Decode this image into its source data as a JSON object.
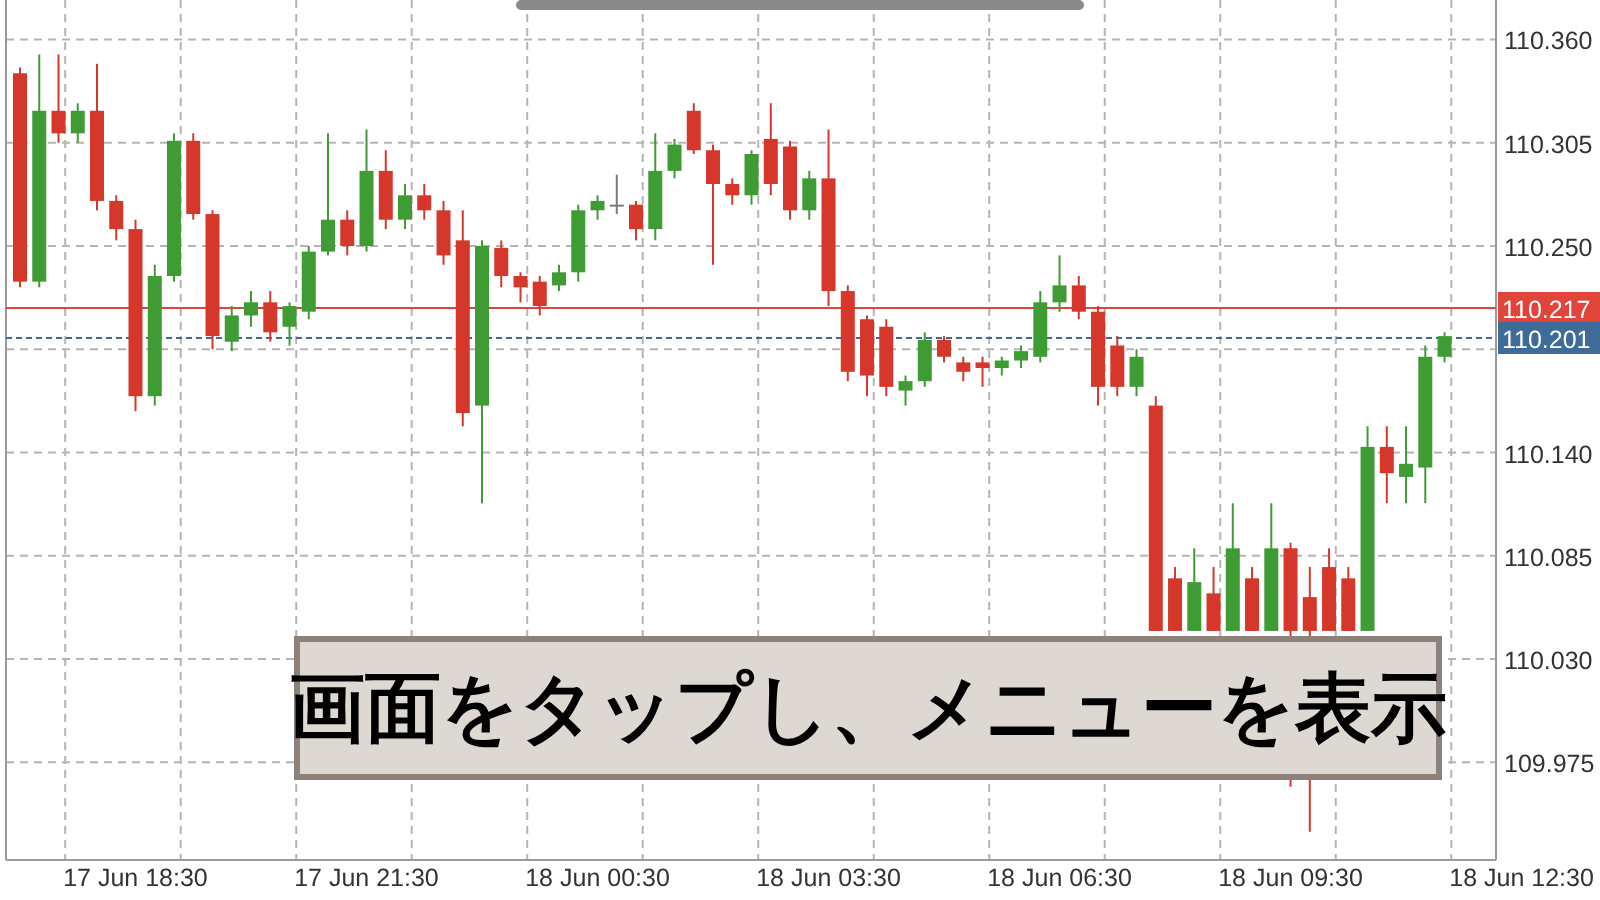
{
  "chart": {
    "chart_data": {
      "type": "candlestick",
      "grid": true,
      "ylim": [
        109.923,
        110.381
      ],
      "yticks": [
        {
          "value": 110.36,
          "label": "110.360"
        },
        {
          "value": 110.305,
          "label": "110.305"
        },
        {
          "value": 110.25,
          "label": "110.250"
        },
        {
          "value": 110.14,
          "label": "110.140"
        },
        {
          "value": 110.085,
          "label": "110.085"
        },
        {
          "value": 110.03,
          "label": "110.030"
        },
        {
          "value": 109.975,
          "label": "109.975"
        }
      ],
      "categories": [
        null,
        null,
        null,
        null,
        null,
        null,
        "17 Jun 18:30",
        null,
        null,
        null,
        null,
        null,
        null,
        null,
        null,
        null,
        null,
        null,
        "17 Jun 21:30",
        null,
        null,
        null,
        null,
        null,
        null,
        null,
        null,
        null,
        null,
        null,
        "18 Jun 00:30",
        null,
        null,
        null,
        null,
        null,
        null,
        null,
        null,
        null,
        null,
        null,
        "18 Jun 03:30",
        null,
        null,
        null,
        null,
        null,
        null,
        null,
        null,
        null,
        null,
        null,
        "18 Jun 06:30",
        null,
        null,
        null,
        null,
        null,
        null,
        null,
        null,
        null,
        null,
        null,
        "18 Jun 09:30",
        null,
        null,
        null,
        null,
        null,
        null,
        null,
        null,
        null,
        null,
        null,
        "18 Jun 12:30"
      ],
      "ohlc": [
        [
          110.342,
          110.345,
          110.228,
          110.231
        ],
        [
          110.231,
          110.352,
          110.228,
          110.322
        ],
        [
          110.322,
          110.352,
          110.305,
          110.31
        ],
        [
          110.31,
          110.326,
          110.305,
          110.322
        ],
        [
          110.322,
          110.347,
          110.269,
          110.274
        ],
        [
          110.274,
          110.277,
          110.253,
          110.259
        ],
        [
          110.259,
          110.264,
          110.162,
          110.17
        ],
        [
          110.17,
          110.24,
          110.165,
          110.234
        ],
        [
          110.234,
          110.31,
          110.231,
          110.306
        ],
        [
          110.306,
          110.31,
          110.264,
          110.267
        ],
        [
          110.267,
          110.269,
          110.195,
          110.202
        ],
        [
          110.199,
          110.218,
          110.194,
          110.213
        ],
        [
          110.213,
          110.226,
          110.207,
          110.22
        ],
        [
          110.22,
          110.226,
          110.199,
          110.204
        ],
        [
          110.207,
          110.22,
          110.197,
          110.218
        ],
        [
          110.215,
          110.25,
          110.211,
          110.247
        ],
        [
          110.247,
          110.31,
          110.245,
          110.264
        ],
        [
          110.264,
          110.269,
          110.245,
          110.25
        ],
        [
          110.25,
          110.312,
          110.247,
          110.29
        ],
        [
          110.29,
          110.301,
          110.259,
          110.264
        ],
        [
          110.264,
          110.283,
          110.259,
          110.277
        ],
        [
          110.277,
          110.283,
          110.264,
          110.269
        ],
        [
          110.269,
          110.274,
          110.24,
          110.245
        ],
        [
          110.253,
          110.269,
          110.154,
          110.161
        ],
        [
          110.165,
          110.253,
          110.113,
          110.25
        ],
        [
          110.249,
          110.253,
          110.228,
          110.234
        ],
        [
          110.234,
          110.236,
          110.22,
          110.228
        ],
        [
          110.231,
          110.234,
          110.213,
          110.218
        ],
        [
          110.229,
          110.24,
          110.226,
          110.236
        ],
        [
          110.236,
          110.272,
          110.231,
          110.269
        ],
        [
          110.269,
          110.277,
          110.264,
          110.274
        ],
        [
          110.272,
          110.288,
          110.267,
          110.272
        ],
        [
          110.272,
          110.274,
          110.253,
          110.259
        ],
        [
          110.259,
          110.31,
          110.253,
          110.29
        ],
        [
          110.29,
          110.307,
          110.286,
          110.304
        ],
        [
          110.322,
          110.326,
          110.299,
          110.301
        ],
        [
          110.301,
          110.304,
          110.24,
          110.283
        ],
        [
          110.283,
          110.286,
          110.272,
          110.277
        ],
        [
          110.277,
          110.301,
          110.272,
          110.299
        ],
        [
          110.307,
          110.326,
          110.277,
          110.283
        ],
        [
          110.303,
          110.306,
          110.264,
          110.269
        ],
        [
          110.269,
          110.29,
          110.264,
          110.286
        ],
        [
          110.286,
          110.312,
          110.218,
          110.226
        ],
        [
          110.226,
          110.229,
          110.178,
          110.183
        ],
        [
          110.211,
          110.213,
          110.17,
          110.181
        ],
        [
          110.207,
          110.211,
          110.17,
          110.175
        ],
        [
          110.173,
          110.181,
          110.165,
          110.178
        ],
        [
          110.178,
          110.204,
          110.175,
          110.2
        ],
        [
          110.2,
          110.202,
          110.188,
          110.191
        ],
        [
          110.188,
          110.191,
          110.178,
          110.183
        ],
        [
          110.188,
          110.191,
          110.175,
          110.185
        ],
        [
          110.185,
          110.191,
          110.181,
          110.189
        ],
        [
          110.189,
          110.197,
          110.185,
          110.194
        ],
        [
          110.191,
          110.226,
          110.188,
          110.22
        ],
        [
          110.22,
          110.245,
          110.215,
          110.229
        ],
        [
          110.229,
          110.234,
          110.211,
          110.215
        ],
        [
          110.215,
          110.218,
          110.165,
          110.175
        ],
        [
          110.197,
          110.202,
          110.17,
          110.175
        ],
        [
          110.175,
          110.195,
          110.17,
          110.191
        ],
        [
          110.165,
          110.17,
          110.045,
          110.045
        ],
        [
          110.073,
          110.079,
          110.045,
          110.045
        ],
        [
          110.045,
          110.089,
          110.045,
          110.071
        ],
        [
          110.065,
          110.079,
          110.045,
          110.045
        ],
        [
          110.045,
          110.113,
          110.045,
          110.089
        ],
        [
          110.073,
          110.079,
          110.045,
          110.045
        ],
        [
          110.045,
          110.113,
          110.045,
          110.089
        ],
        [
          110.089,
          110.092,
          109.962,
          110.045
        ],
        [
          110.063,
          110.079,
          109.938,
          110.045
        ],
        [
          110.079,
          110.089,
          110.045,
          110.045
        ],
        [
          110.073,
          110.079,
          110.045,
          110.045
        ],
        [
          110.045,
          110.154,
          110.045,
          110.143
        ],
        [
          110.143,
          110.154,
          110.113,
          110.129
        ],
        [
          110.127,
          110.154,
          110.113,
          110.134
        ],
        [
          110.132,
          110.197,
          110.113,
          110.191
        ],
        [
          110.191,
          110.204,
          110.188,
          110.202
        ],
        null,
        null,
        null,
        null
      ],
      "ref_lines": [
        {
          "axis": "y",
          "value": 110.217,
          "label": "110.217",
          "color": "#e0443a"
        },
        {
          "axis": "y",
          "value": 110.201,
          "label": "110.201",
          "color": "#3f6b98"
        }
      ]
    },
    "overlay_message": "画面をタップし、メニューを表示"
  }
}
